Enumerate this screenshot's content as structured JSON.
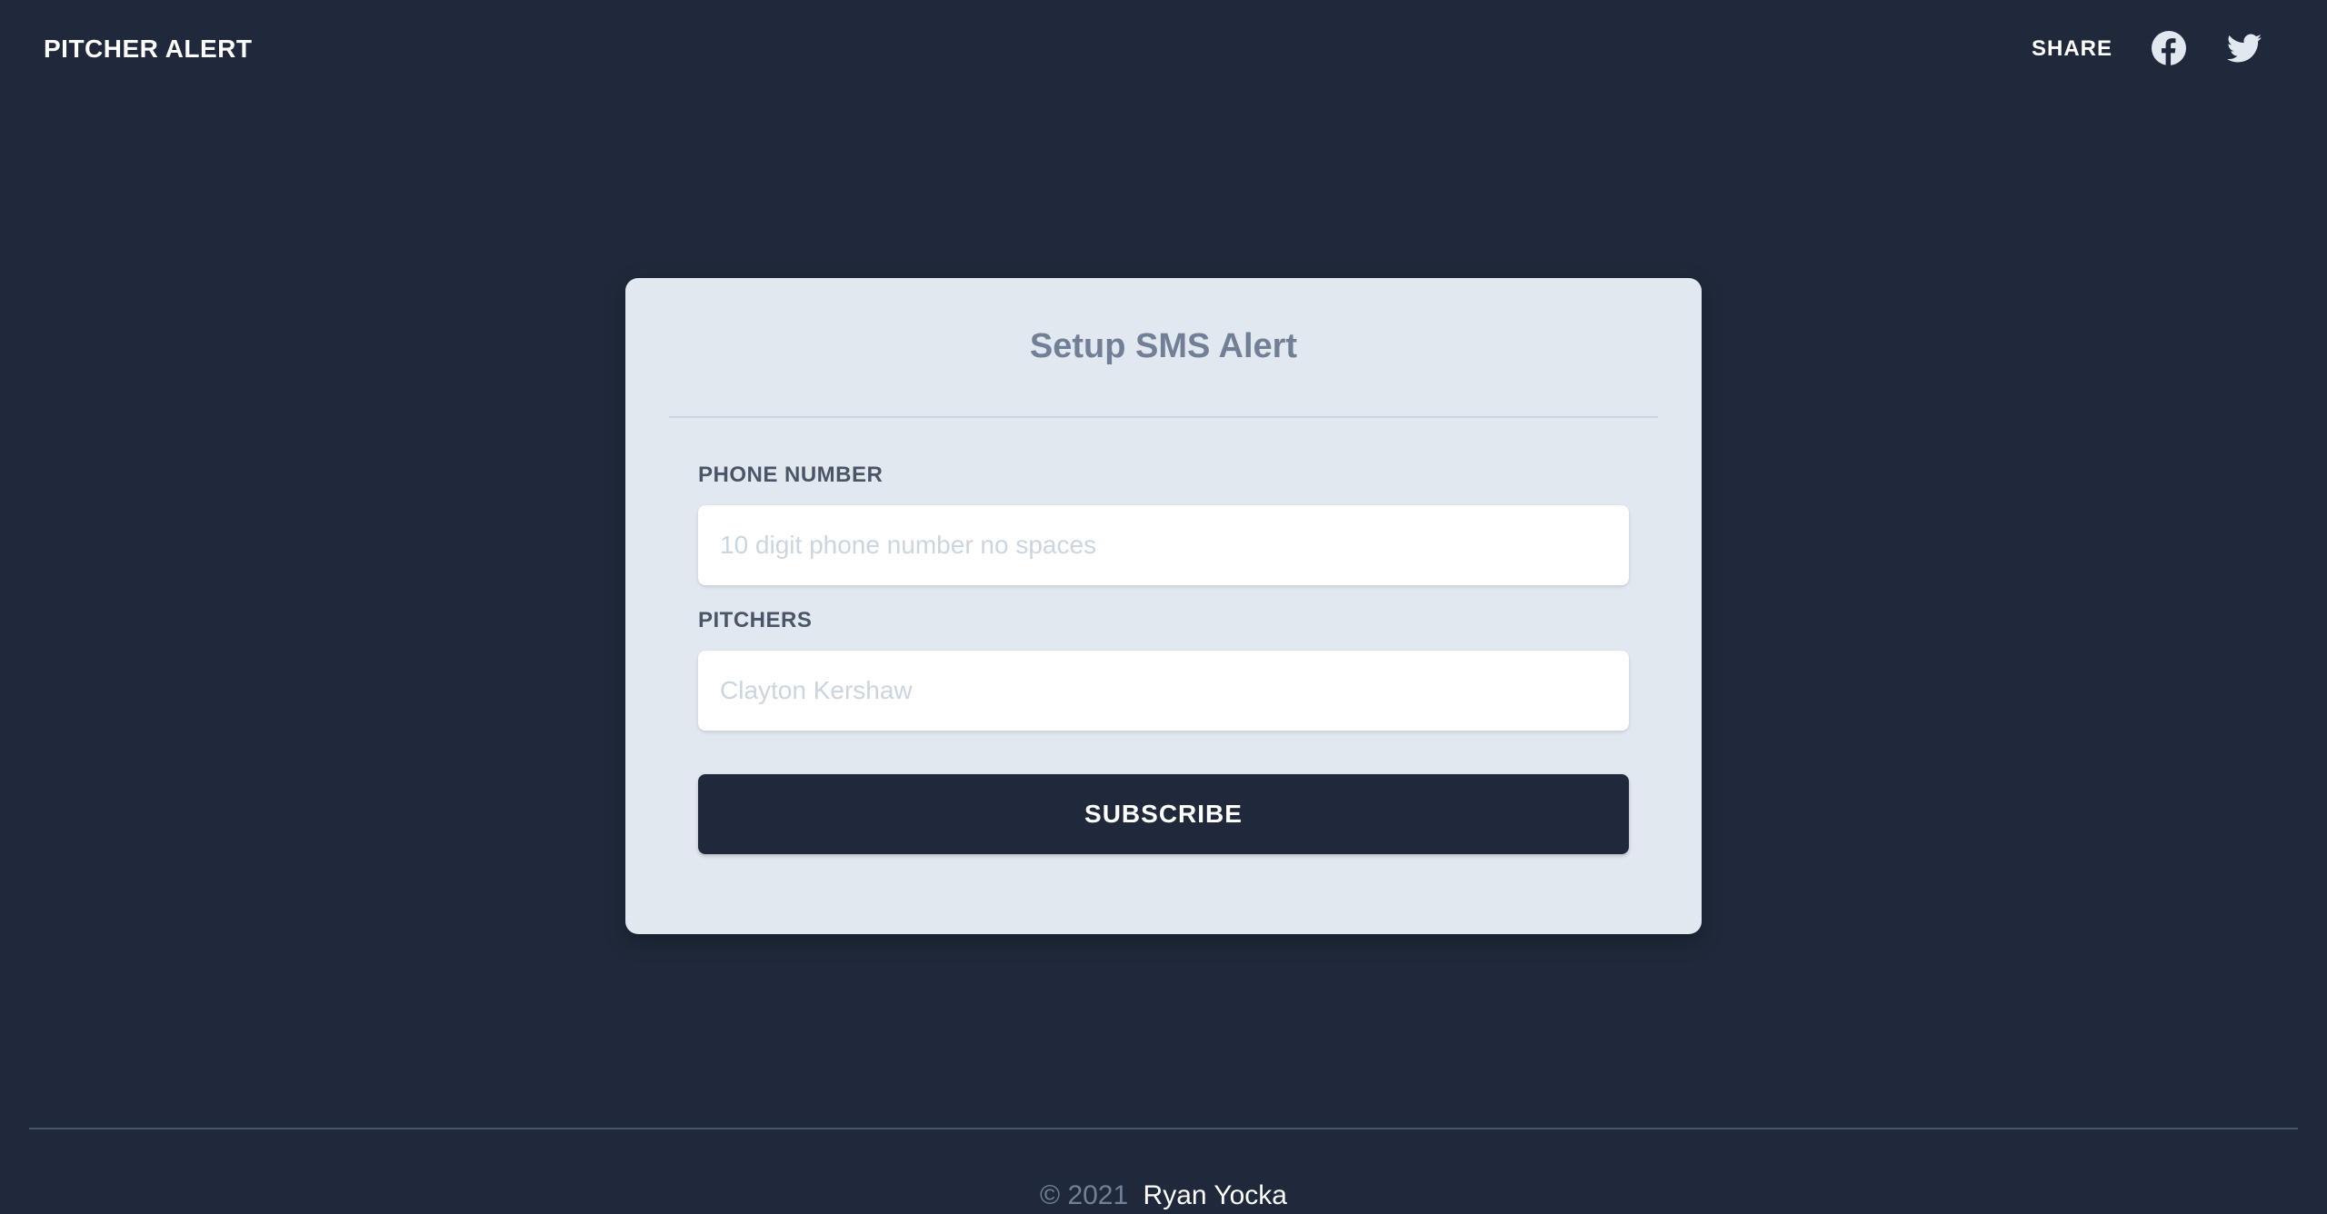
{
  "header": {
    "brand": "PITCHER ALERT",
    "share_label": "SHARE",
    "icons": [
      "facebook-icon",
      "twitter-icon"
    ]
  },
  "form": {
    "title": "Setup SMS Alert",
    "phone": {
      "label": "PHONE NUMBER",
      "placeholder": "10 digit phone number no spaces",
      "value": ""
    },
    "pitchers": {
      "label": "PITCHERS",
      "placeholder": "Clayton Kershaw",
      "value": ""
    },
    "submit_label": "SUBSCRIBE"
  },
  "footer": {
    "copyright": "© 2021",
    "author": "Ryan Yocka"
  },
  "colors": {
    "page_background": "#1f293b",
    "card_background": "#e2e8f0",
    "button_background": "#1f293b",
    "title_text": "#718096"
  }
}
